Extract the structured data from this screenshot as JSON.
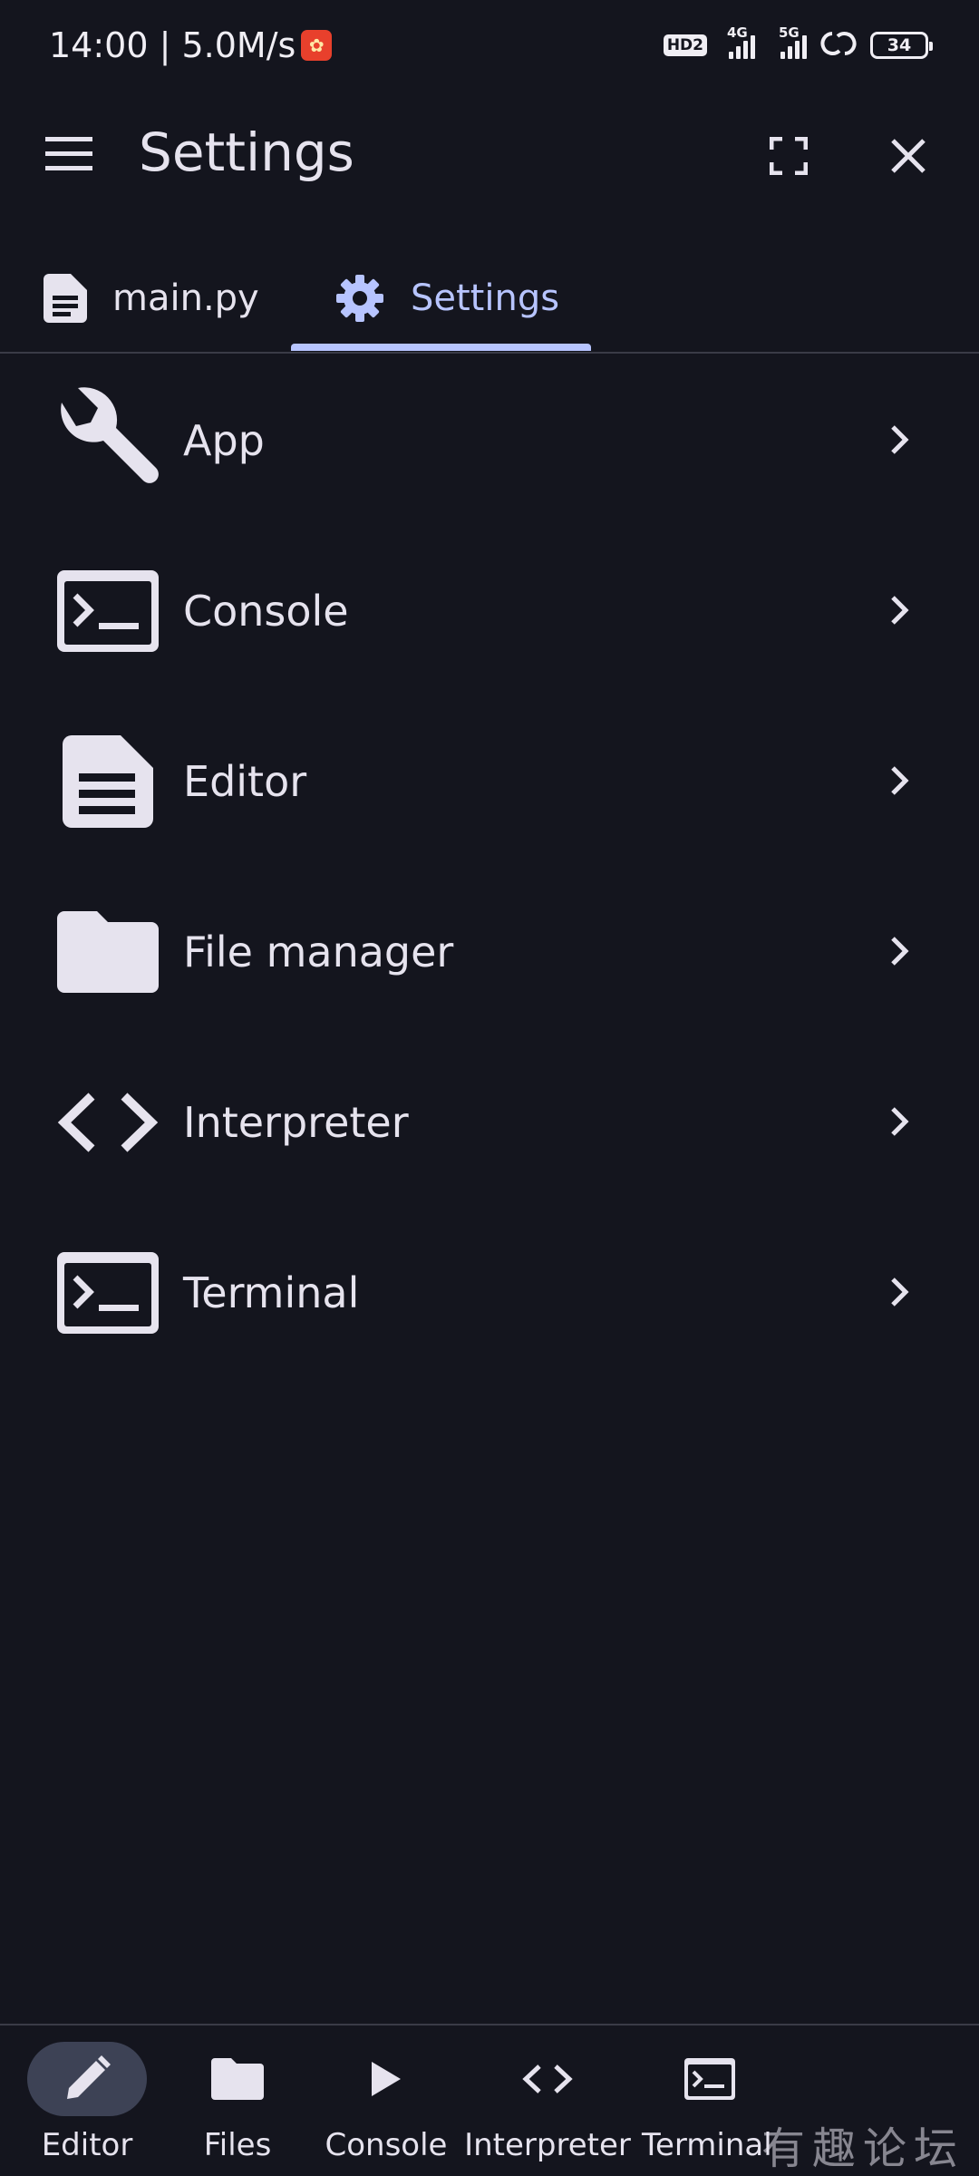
{
  "status_bar": {
    "time_speed": "14:00 | 5.0M/s",
    "hd": "HD2",
    "net1": "4G",
    "net2": "5G",
    "battery": "34"
  },
  "header": {
    "title": "Settings"
  },
  "tabs": [
    {
      "label": "main.py",
      "icon": "document-icon",
      "active": false
    },
    {
      "label": "Settings",
      "icon": "gear-icon",
      "active": true
    }
  ],
  "settings_items": [
    {
      "label": "App",
      "icon": "wrench-icon"
    },
    {
      "label": "Console",
      "icon": "terminal-icon"
    },
    {
      "label": "Editor",
      "icon": "document-icon"
    },
    {
      "label": "File manager",
      "icon": "folder-icon"
    },
    {
      "label": "Interpreter",
      "icon": "code-icon"
    },
    {
      "label": "Terminal",
      "icon": "terminal-icon"
    }
  ],
  "bottom_nav": [
    {
      "label": "Editor",
      "icon": "pencil-icon",
      "active": true
    },
    {
      "label": "Files",
      "icon": "folder-icon",
      "active": false
    },
    {
      "label": "Console",
      "icon": "play-icon",
      "active": false
    },
    {
      "label": "Interpreter",
      "icon": "code-icon",
      "active": false
    },
    {
      "label": "Terminal",
      "icon": "terminal-icon",
      "active": false
    }
  ],
  "watermark": "有趣论坛",
  "colors": {
    "background": "#14151e",
    "accent": "#b7c4ff",
    "text": "#e6e3ee",
    "active_pill": "#3d4255"
  }
}
